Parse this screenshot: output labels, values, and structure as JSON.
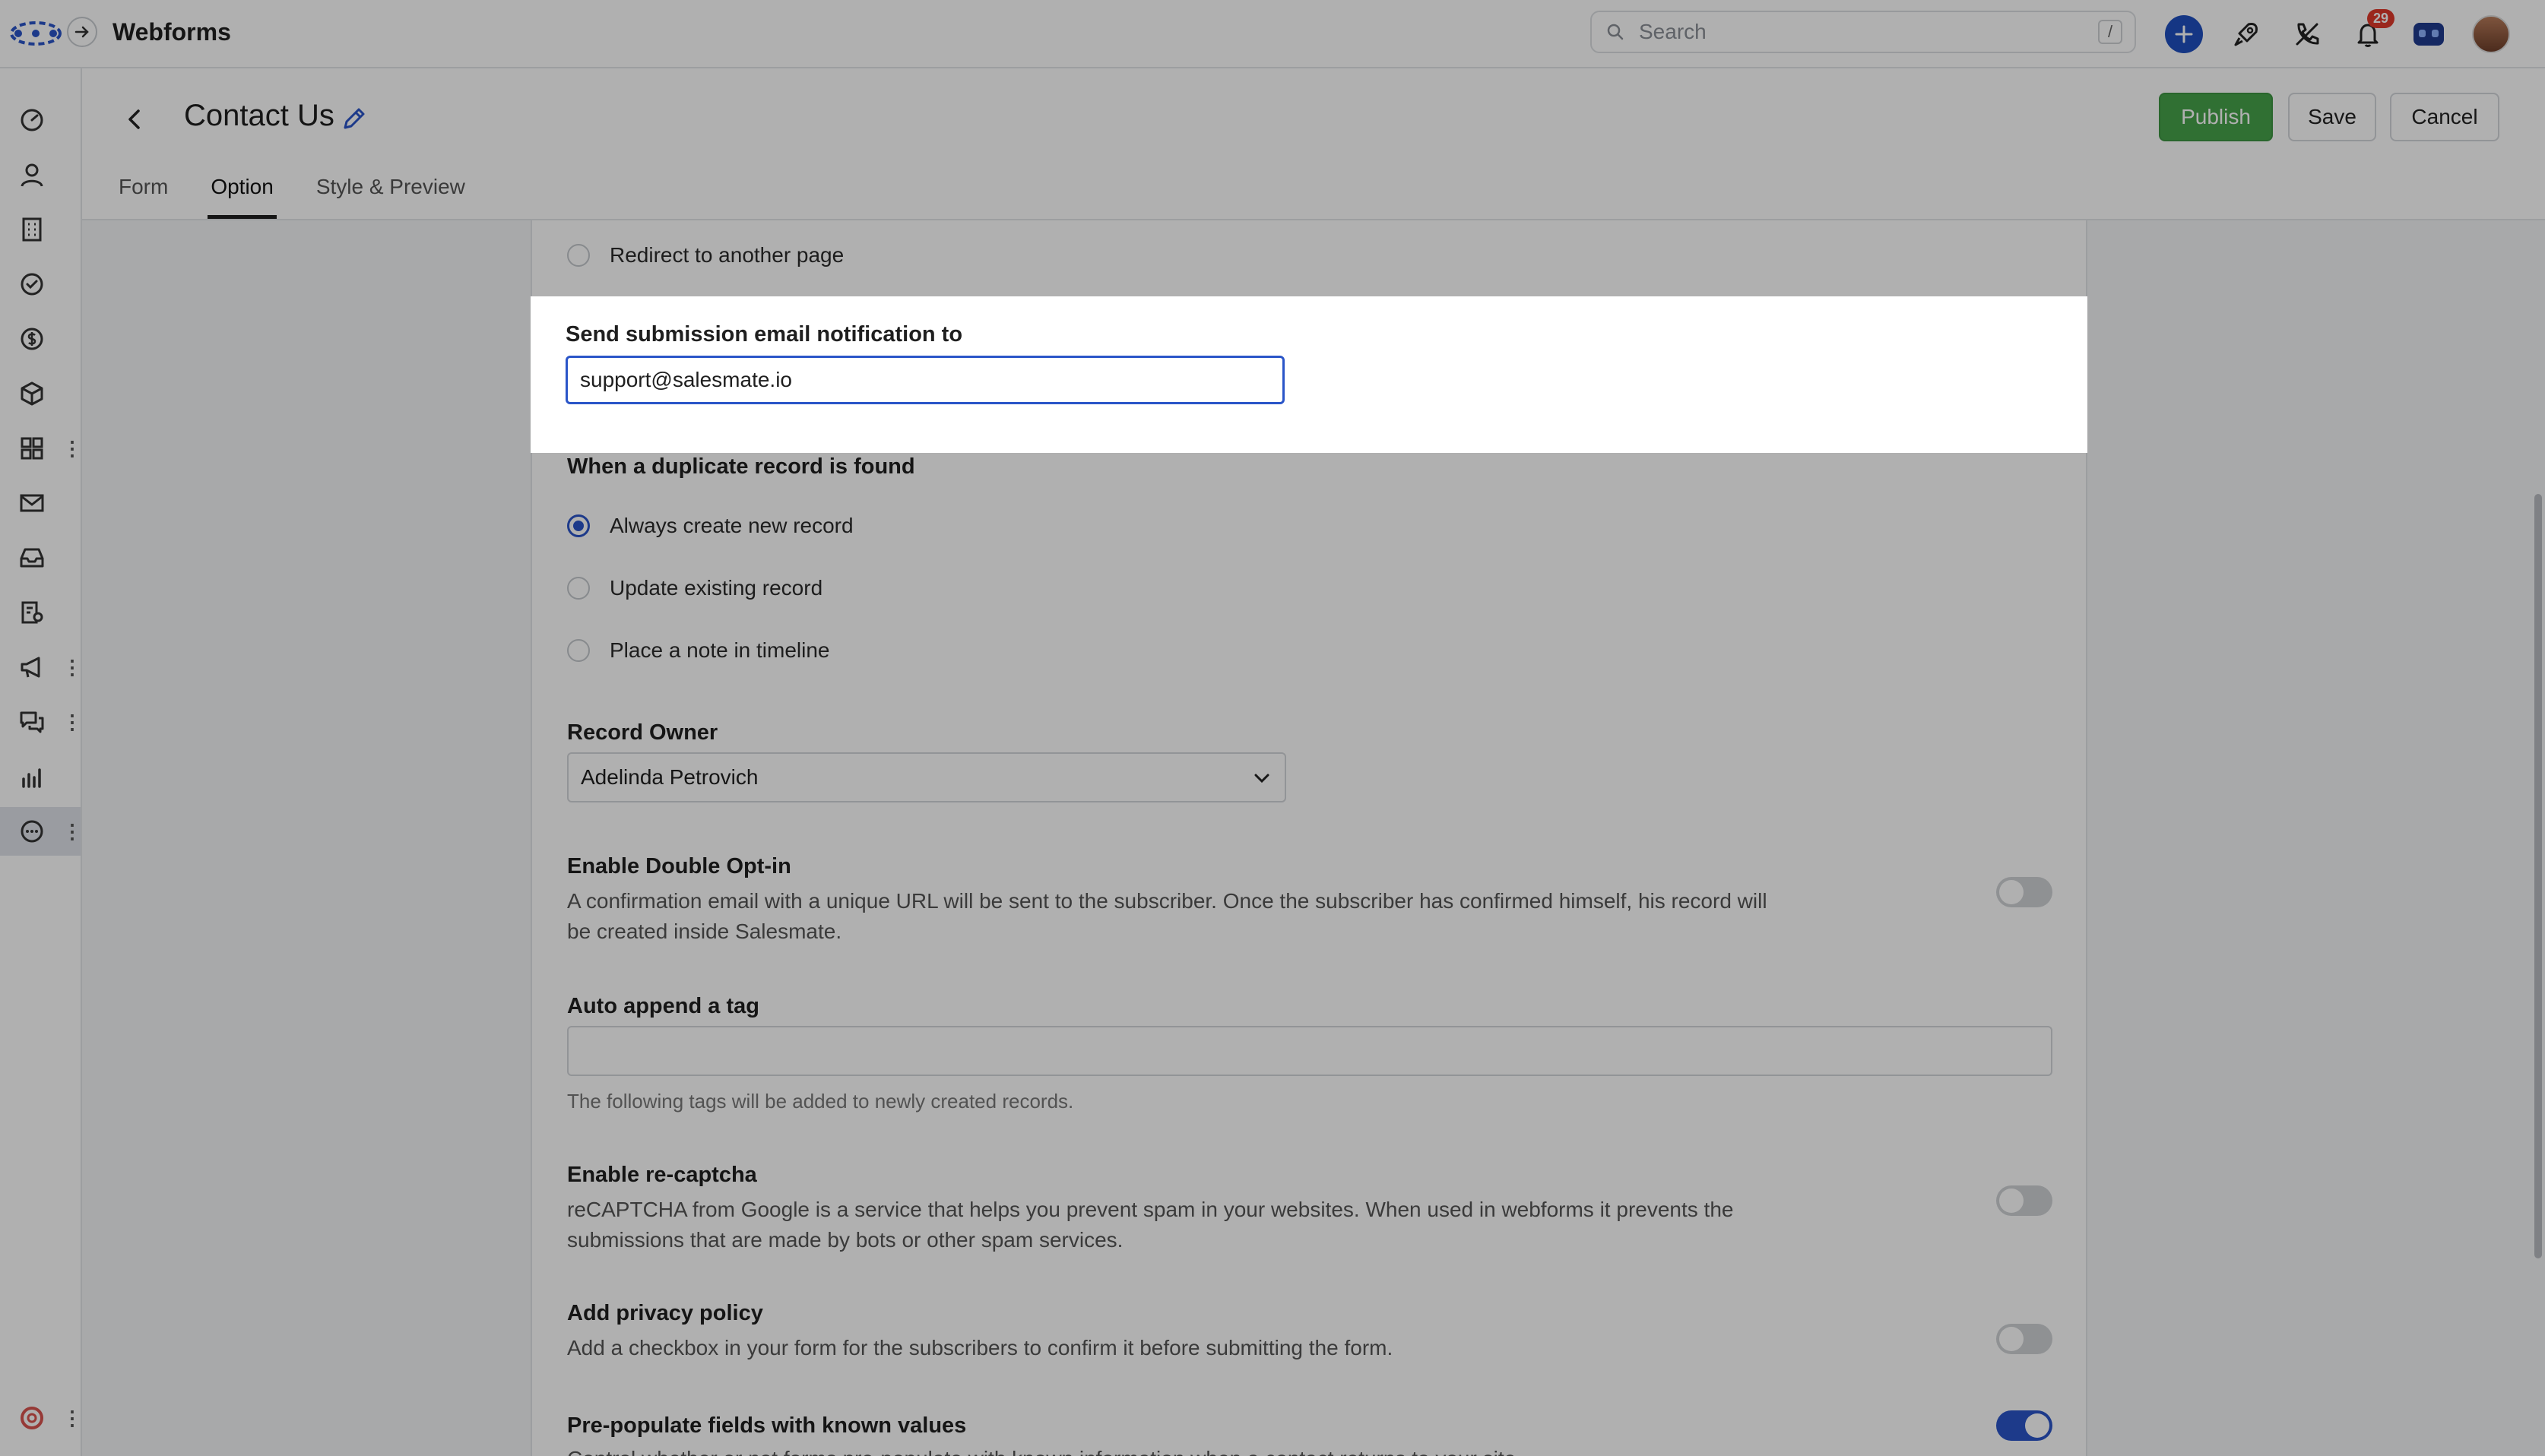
{
  "app": {
    "title": "Webforms"
  },
  "search": {
    "placeholder": "Search",
    "shortcut": "/"
  },
  "notifications": {
    "count": "29"
  },
  "header": {
    "form_title": "Contact Us",
    "publish_label": "Publish",
    "save_label": "Save",
    "cancel_label": "Cancel"
  },
  "tabs": [
    {
      "label": "Form"
    },
    {
      "label": "Option"
    },
    {
      "label": "Style & Preview"
    }
  ],
  "redirect": {
    "label": "Redirect to another page"
  },
  "email_notification": {
    "label": "Send submission email notification to",
    "value": "support@salesmate.io"
  },
  "duplicate": {
    "label": "When a duplicate record is found",
    "options": [
      {
        "label": "Always create new record",
        "checked": true
      },
      {
        "label": "Update existing record",
        "checked": false
      },
      {
        "label": "Place a note in timeline",
        "checked": false
      }
    ]
  },
  "record_owner": {
    "label": "Record Owner",
    "value": "Adelinda Petrovich"
  },
  "double_optin": {
    "label": "Enable Double Opt-in",
    "desc": "A confirmation email with a unique URL will be sent to the subscriber. Once the subscriber has confirmed himself, his record will be created inside Salesmate.",
    "enabled": false
  },
  "auto_tag": {
    "label": "Auto append a tag",
    "value": "",
    "hint": "The following tags will be added to newly created records."
  },
  "recaptcha": {
    "label": "Enable re-captcha",
    "desc": "reCAPTCHA from Google is a service that helps you prevent spam in your websites. When used in webforms it prevents the submissions that are made by bots or other spam services.",
    "enabled": false
  },
  "privacy": {
    "label": "Add privacy policy",
    "desc": "Add a checkbox in your form for the subscribers to confirm it before submitting the form.",
    "enabled": false
  },
  "prepopulate": {
    "label": "Pre-populate fields with known values",
    "desc": "Control whether or not forms pre-populate with known information when a contact returns to your site.",
    "enabled": true
  },
  "sidebar": {
    "items": [
      {
        "icon": "dashboard-icon"
      },
      {
        "icon": "contacts-icon"
      },
      {
        "icon": "companies-icon"
      },
      {
        "icon": "tasks-icon"
      },
      {
        "icon": "deals-icon"
      },
      {
        "icon": "products-icon"
      },
      {
        "icon": "apps-icon"
      },
      {
        "icon": "email-icon"
      },
      {
        "icon": "inbox-icon"
      },
      {
        "icon": "sequences-icon"
      },
      {
        "icon": "campaigns-icon"
      },
      {
        "icon": "chat-icon"
      },
      {
        "icon": "reports-icon"
      },
      {
        "icon": "more-icon"
      },
      {
        "icon": "help-icon"
      }
    ]
  }
}
